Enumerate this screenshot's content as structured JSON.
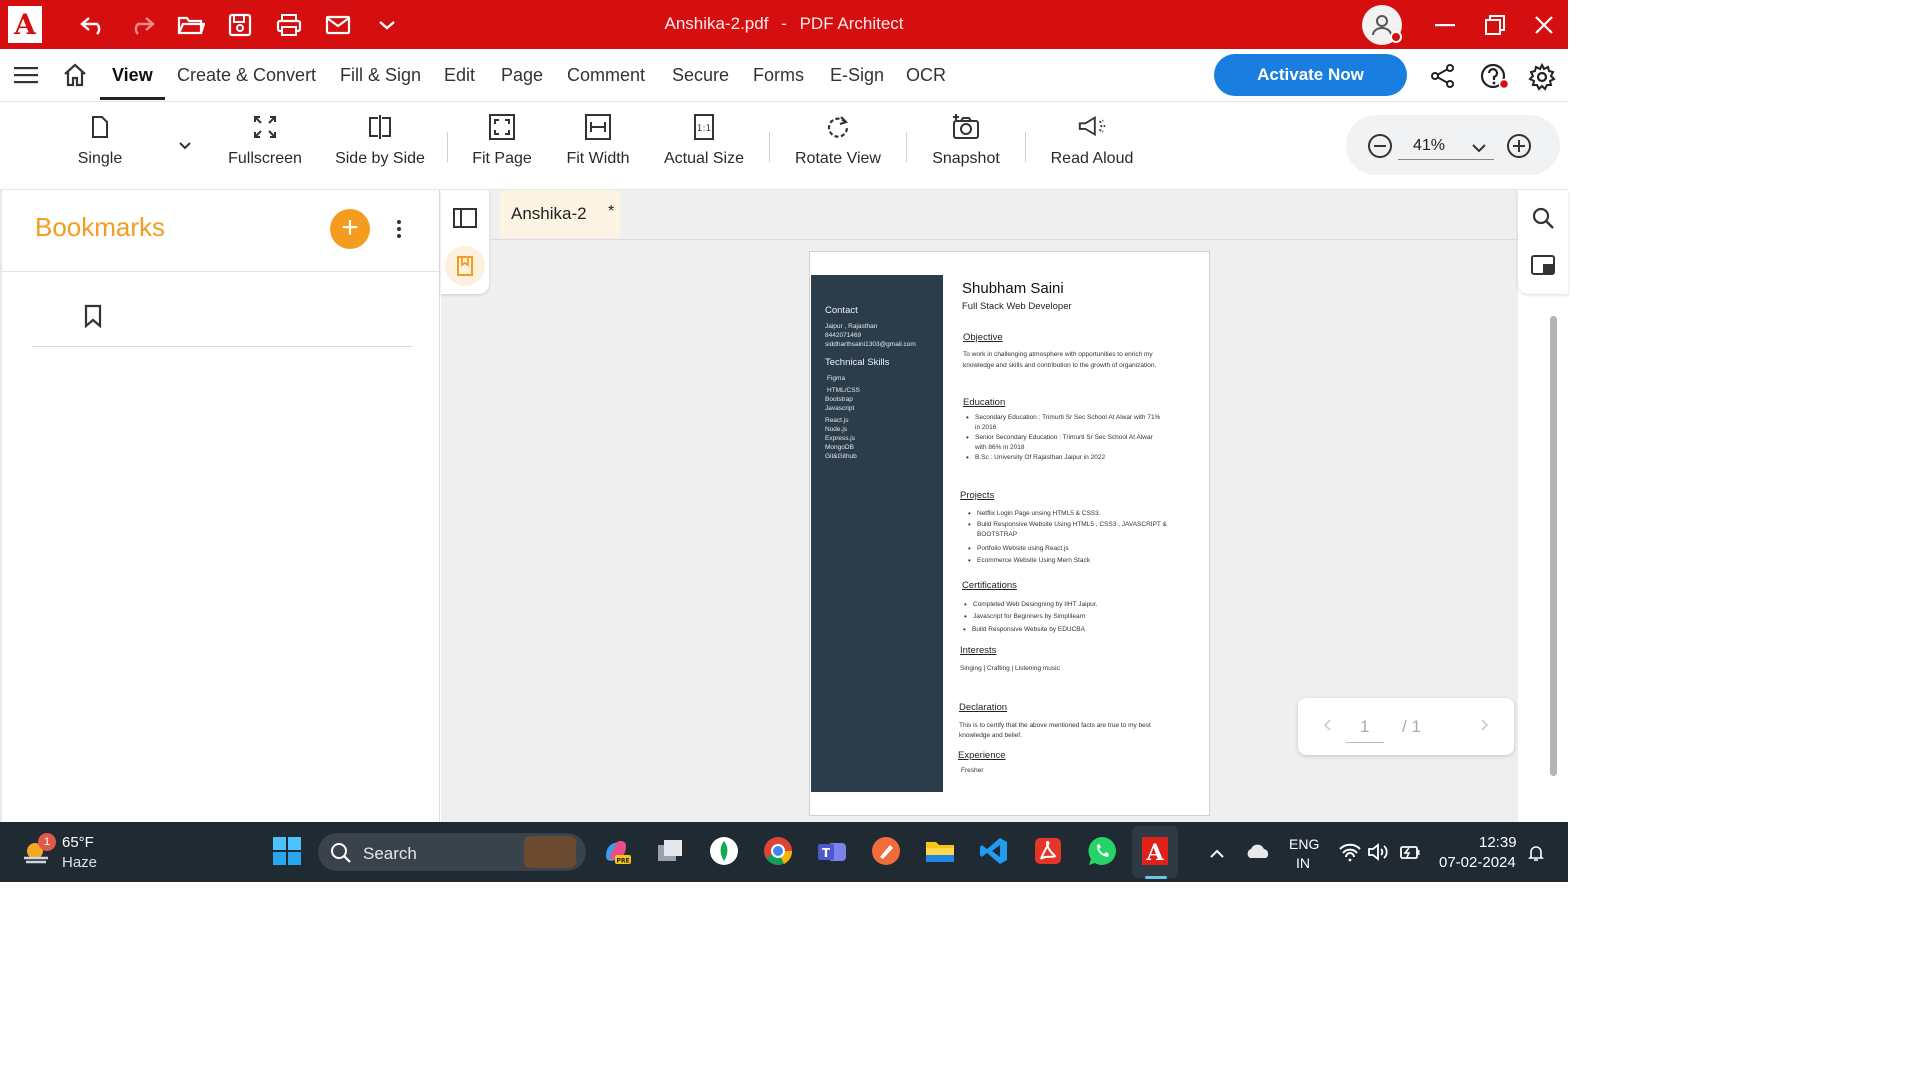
{
  "window": {
    "file_name": "Anshika-2.pdf",
    "separator": "-",
    "app_name": "PDF Architect"
  },
  "menu": {
    "items": [
      "View",
      "Create & Convert",
      "Fill & Sign",
      "Edit",
      "Page",
      "Comment",
      "Secure",
      "Forms",
      "E-Sign",
      "OCR"
    ],
    "activate_label": "Activate Now"
  },
  "toolbar": {
    "single": "Single",
    "fullscreen": "Fullscreen",
    "side_by_side": "Side by Side",
    "fit_page": "Fit Page",
    "fit_width": "Fit Width",
    "actual_size": "Actual Size",
    "rotate_view": "Rotate View",
    "snapshot": "Snapshot",
    "read_aloud": "Read Aloud",
    "zoom": "41%"
  },
  "bookmarks": {
    "title": "Bookmarks"
  },
  "tab": {
    "name": "Anshika-2",
    "modified_marker": "*"
  },
  "resume": {
    "name": "Shubham Saini",
    "role": "Full Stack Web Developer",
    "contact_heading": "Contact",
    "contact": [
      "Jaipur , Rajasthan",
      "8442071469",
      "siddharthsaini1303@gmail.com"
    ],
    "skills_heading": "Technical  Skills",
    "skills": [
      "Figma",
      "HTML/CSS",
      "Bootstrap",
      "Javascript",
      "React.js",
      "Node.js",
      "Express.js",
      "MongoDB",
      "Git&Github"
    ],
    "objective_heading": "Objective",
    "objective_lines": [
      "To work in challenging atmosphere with opportunities to enrich my",
      "knowledge and skills and contribution to the growth of organization."
    ],
    "education_heading": "Education",
    "education": [
      [
        "Secondary Education : Trimurti Sr Sec School At Alwar  with 71%",
        "in 2016"
      ],
      [
        "Senior Secondary Education :  Trimurti Sr Sec School At Alwar",
        "with 86% in 2018"
      ],
      [
        "B.Sc : University Of Rajasthan Jaipur in 2022"
      ]
    ],
    "projects_heading": "Projects",
    "projects": [
      [
        "Netflix Login Page unsing HTML5 & CSS3."
      ],
      [
        "Build Responsive Website Using HTML5 , CSS3 , JAVASCRIPT &",
        "BOOTSTRAP"
      ],
      [
        "Portfolio Website using React.js"
      ],
      [
        "Ecommerce Website Using Mern Stack"
      ]
    ],
    "certifications_heading": "Certifications",
    "certifications": [
      "Completed Web Desingning by IIHT Jaipur.",
      "Javascript for Beginners by Simplilearn",
      "Build Responsive Website by EDUCBA"
    ],
    "interests_heading": "Interests",
    "interests": "Singing | Crafting | Listening music",
    "declaration_heading": "Declaration",
    "declaration_lines": [
      "This is to certify that the above mentioned facts are true to my best",
      "knowledge and belief."
    ],
    "experience_heading": "Experience",
    "experience": "Fresher"
  },
  "page_nav": {
    "current": "1",
    "total": "/ 1"
  },
  "taskbar": {
    "weather_temp": "65°F",
    "weather_desc": "Haze",
    "weather_badge": "1",
    "search_label": "Search",
    "lang_top": "ENG",
    "lang_bottom": "IN",
    "time": "12:39",
    "date": "07-02-2024"
  },
  "colors": {
    "title_bar": "#d50f0f",
    "accent_orange": "#f39c1f",
    "activate_blue": "#1a7ee0",
    "resume_sidebar": "#2b3d4a",
    "taskbar": "#1f2a33"
  }
}
